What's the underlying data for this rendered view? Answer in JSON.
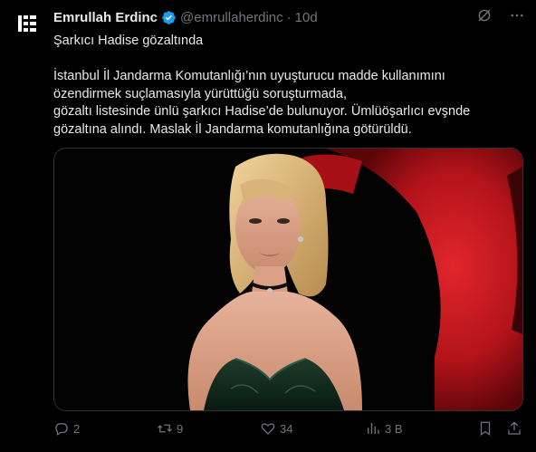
{
  "author": {
    "name": "Emrullah Erdinc",
    "handle": "@emrullaherdinc",
    "separator": "·",
    "time": "10d",
    "avatar_icon": "bbc-style-logo",
    "verified_color": "#1d9bf0"
  },
  "tweet": {
    "headline": "Şarkıcı Hadise gözaltında",
    "lines": [
      "İstanbul İl Jandarma Komutanlığı’nın uyuşturucu madde kullanımını",
      "özendirmek suçlamasıyla yürüttüğü soruşturmada,",
      "gözaltı listesinde ünlü şarkıcı Hadise’de bulunuyor. Ümlüöşarlıcı evşnde",
      "gözaltına alındı. Maslak İl Jandarma komutanlığına götürüldü."
    ]
  },
  "media": {
    "icon": "photo-of-woman-in-red-chair"
  },
  "actions": {
    "replies": "2",
    "reposts": "9",
    "likes": "34",
    "views": "3 B",
    "reply_icon": "reply-icon",
    "repost_icon": "repost-icon",
    "like_icon": "heart-icon",
    "views_icon": "views-chart-icon",
    "bookmark_icon": "bookmark-icon",
    "share_icon": "share-icon"
  },
  "colors": {
    "background": "#000000",
    "text": "#e7e9ea",
    "muted": "#71767b",
    "chair_red": "#c0151b"
  }
}
